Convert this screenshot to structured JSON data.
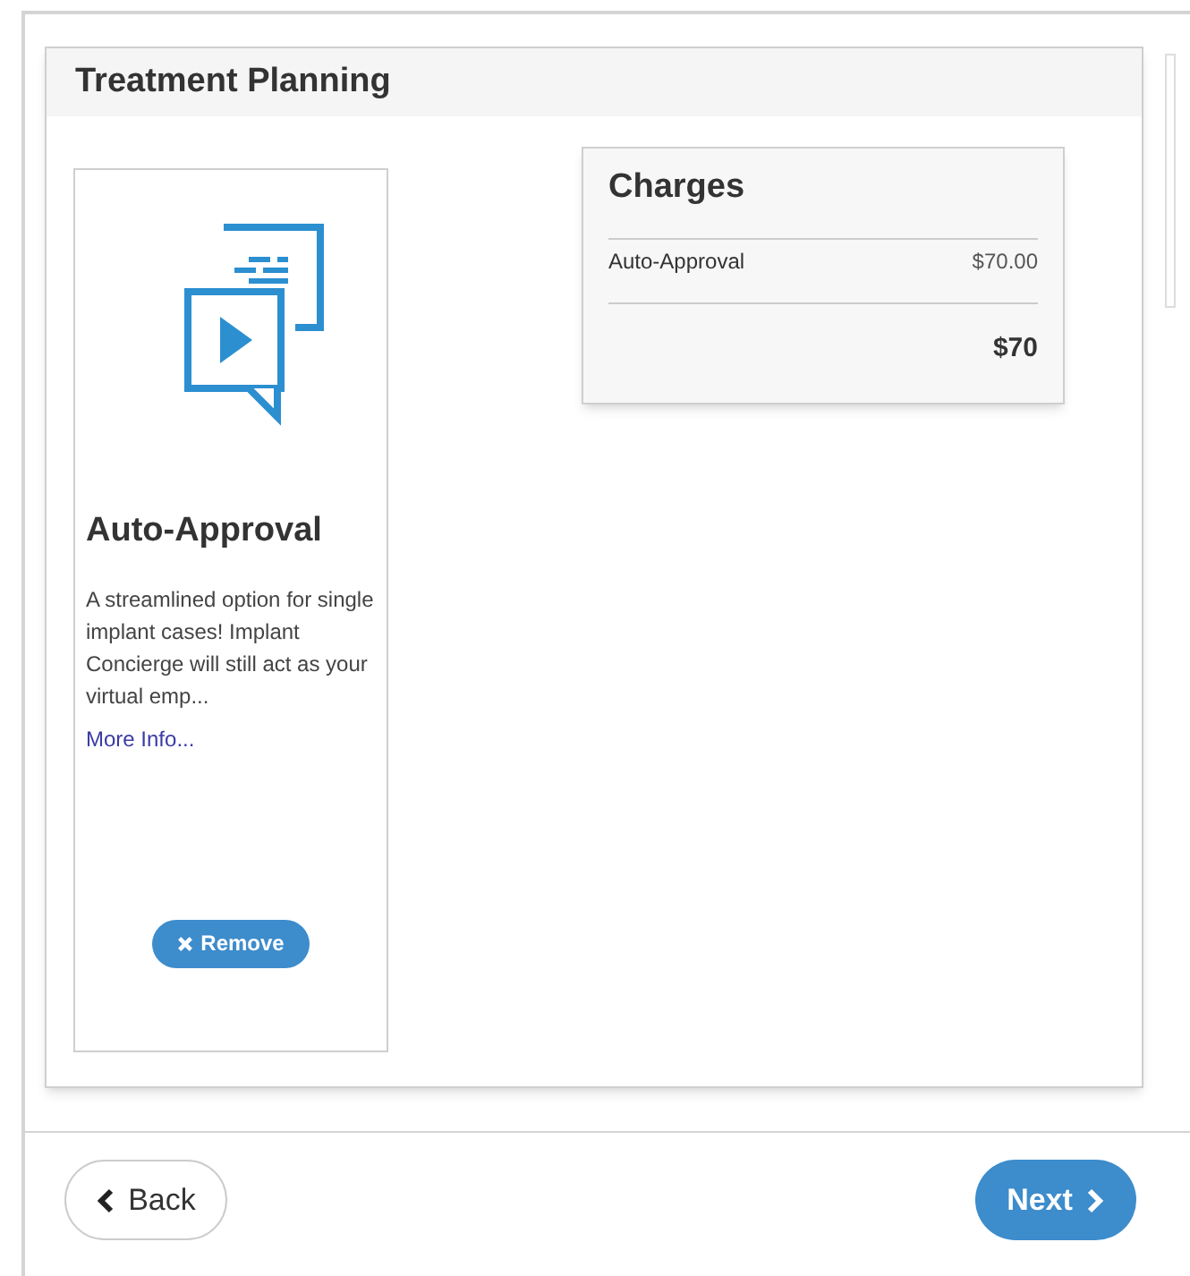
{
  "panel": {
    "title": "Treatment Planning"
  },
  "product": {
    "name": "Auto-Approval",
    "description": "A streamlined option for single implant cases! Implant Concierge will still act as your virtual emp...",
    "more_link": "More Info...",
    "remove_button": "Remove"
  },
  "charges": {
    "title": "Charges",
    "items": [
      {
        "label": "Auto-Approval",
        "amount": "$70.00"
      }
    ],
    "total": "$70"
  },
  "footer": {
    "back_button": "Back",
    "next_button": "Next"
  }
}
